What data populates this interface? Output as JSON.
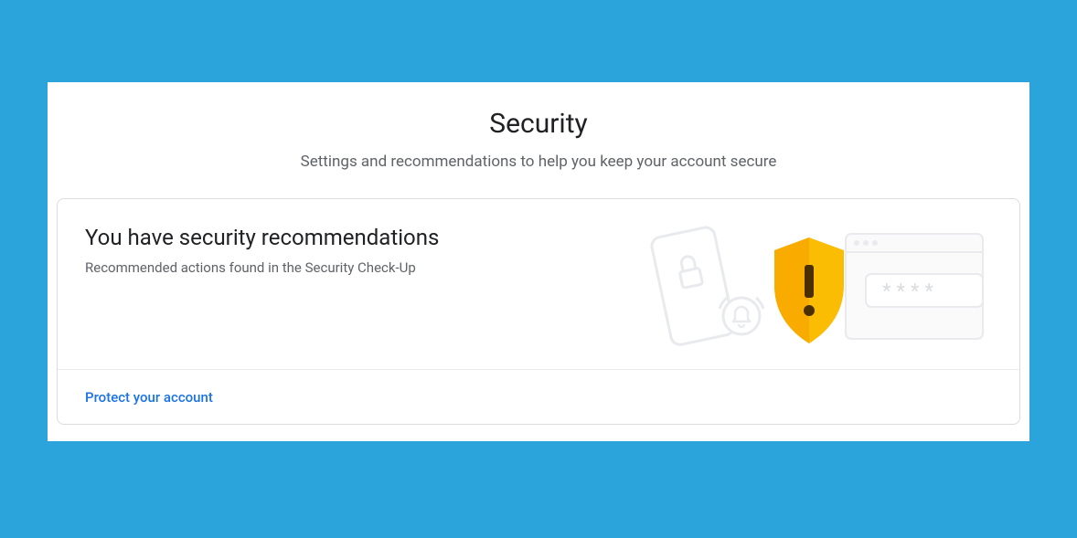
{
  "header": {
    "title": "Security",
    "subtitle": "Settings and recommendations to help you keep your account secure"
  },
  "card": {
    "title": "You have security recommendations",
    "description": "Recommended actions found in the Security Check-Up",
    "action_label": "Protect your account"
  }
}
